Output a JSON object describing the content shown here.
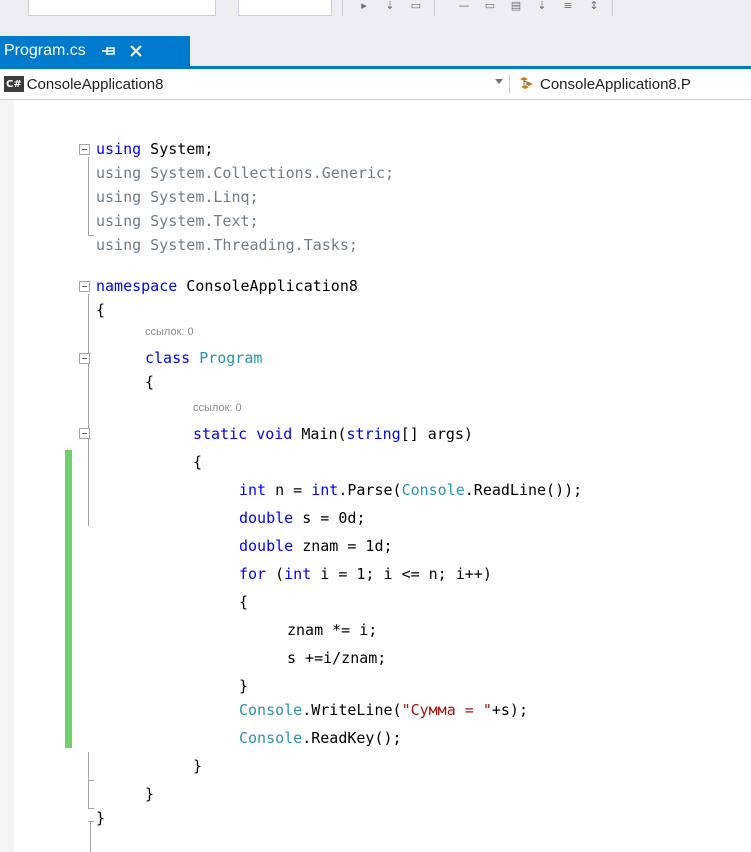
{
  "colors": {
    "tab_active": "#007acc",
    "keyword": "#0000ff",
    "type": "#2b91af",
    "string": "#a31515",
    "change_indicator": "#6fd06c",
    "codelens": "#8a8a8a"
  },
  "tab": {
    "title": "Program.cs",
    "pin_icon": "pin-icon",
    "close_icon": "close-icon"
  },
  "navbar": {
    "project_badge": "C#",
    "project": "ConsoleApplication8",
    "class_path": "ConsoleApplication8.P"
  },
  "code": {
    "using_system": [
      "using",
      " System;"
    ],
    "using_generic": "using System.Collections.Generic;",
    "using_linq": "using System.Linq;",
    "using_text": "using System.Text;",
    "using_tasks": "using System.Threading.Tasks;",
    "namespace_kw": "namespace",
    "namespace_name": " ConsoleApplication8",
    "brace_open": "{",
    "brace_close": "}",
    "codelens_class": "ссылок: 0",
    "class_kw": "class",
    "class_name": "Program",
    "codelens_main": "ссылок: 0",
    "main_static": "static",
    "main_void": "void",
    "main_name": " Main(",
    "main_string": "string",
    "main_rest": "[] args)",
    "l_int1": "int",
    "l_n": " n = ",
    "l_int2": "int",
    "l_parse": ".Parse(",
    "l_console1": "Console",
    "l_readline": ".ReadLine());",
    "l_double1": "double",
    "l_s": " s = 0d;",
    "l_double2": "double",
    "l_znam": " znam = 1d;",
    "l_for": "for",
    "l_for_open": " (",
    "l_int3": "int",
    "l_for_rest": " i = 1; i <= n; i++)",
    "l_znam_mul": "znam *= i;",
    "l_s_add": "s +=i/znam;",
    "l_console2": "Console",
    "l_writeline": ".WriteLine(",
    "l_string": "\"Сумма = \"",
    "l_plus_s": "+s);",
    "l_console3": "Console",
    "l_readkey": ".ReadKey();"
  }
}
